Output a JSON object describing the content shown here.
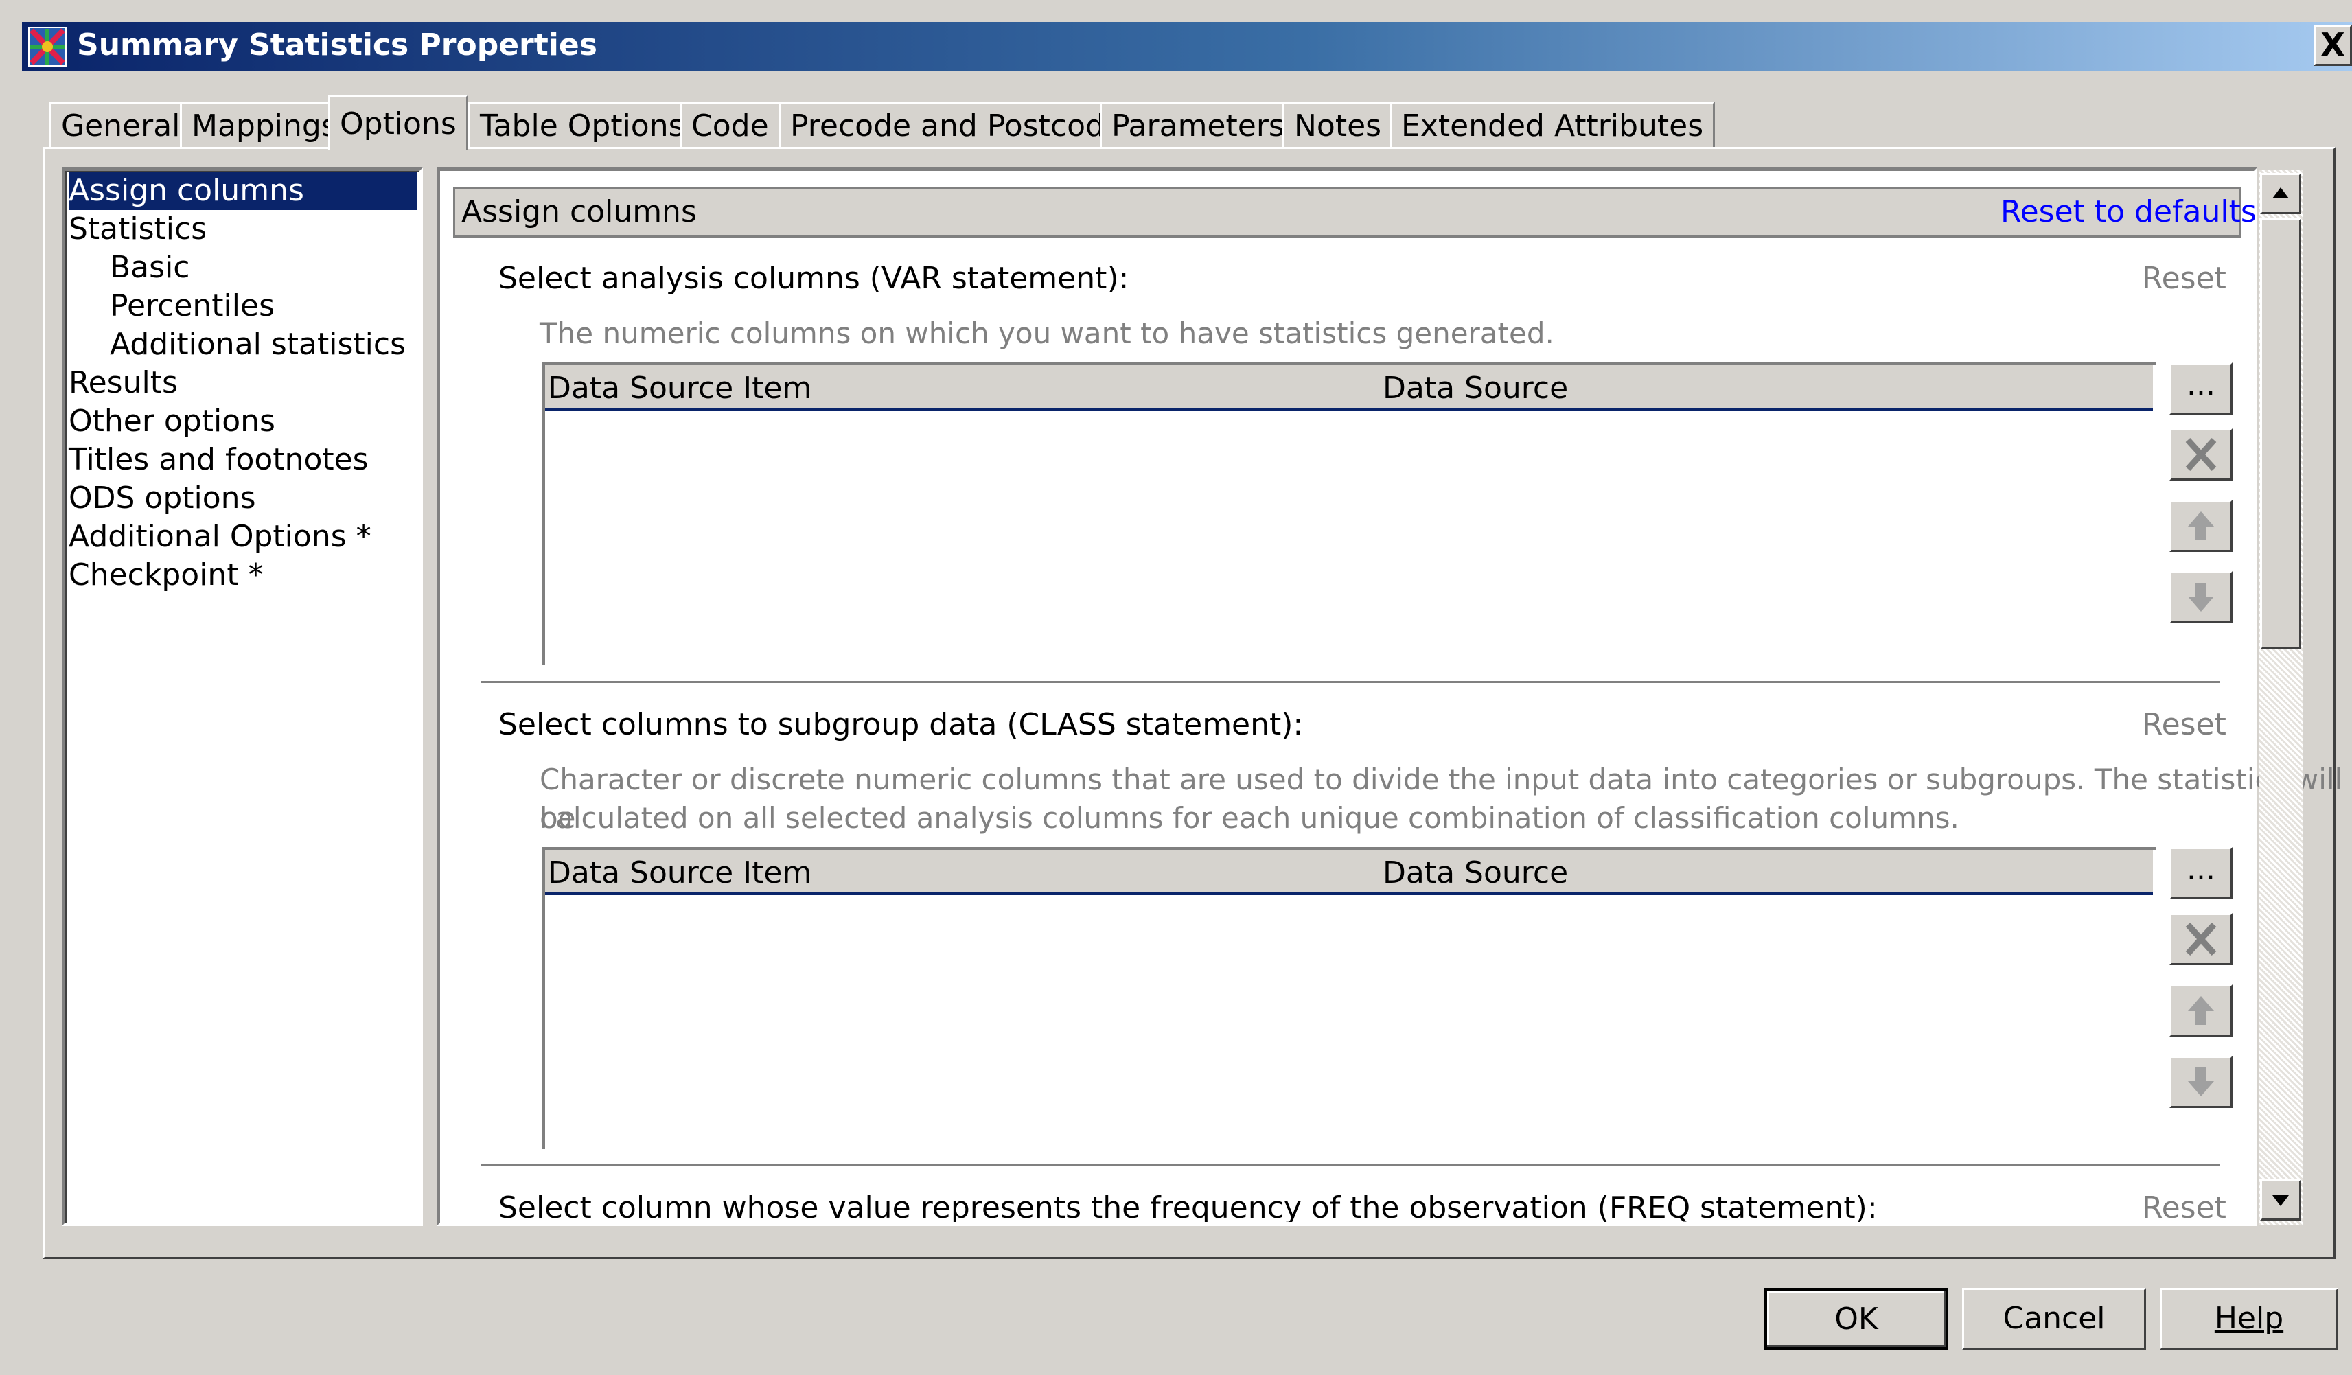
{
  "window": {
    "title": "Summary Statistics Properties",
    "close": "X"
  },
  "tabs": [
    {
      "label": "General"
    },
    {
      "label": "Mappings"
    },
    {
      "label": "Options"
    },
    {
      "label": "Table Options"
    },
    {
      "label": "Code"
    },
    {
      "label": "Precode and Postcode"
    },
    {
      "label": "Parameters"
    },
    {
      "label": "Notes"
    },
    {
      "label": "Extended Attributes"
    }
  ],
  "nav": {
    "items": [
      {
        "label": "Assign columns"
      },
      {
        "label": "Statistics"
      },
      {
        "label": "Basic"
      },
      {
        "label": "Percentiles"
      },
      {
        "label": "Additional statistics"
      },
      {
        "label": "Results"
      },
      {
        "label": "Other options"
      },
      {
        "label": "Titles and footnotes"
      },
      {
        "label": "ODS options"
      },
      {
        "label": "Additional Options *"
      },
      {
        "label": "Checkpoint *"
      }
    ]
  },
  "main": {
    "header_title": "Assign columns",
    "reset_defaults": "Reset to defaults",
    "sections": [
      {
        "label": "Select analysis columns (VAR statement):",
        "reset": "Reset",
        "description": "The numeric columns on which you want to have statistics generated.",
        "col1": "Data Source Item",
        "col2": "Data Source",
        "browse": "..."
      },
      {
        "label": "Select columns to subgroup data (CLASS statement):",
        "reset": "Reset",
        "description_line1": "Character or discrete numeric columns that are used to divide the input data into categories or subgroups. The statistics will be",
        "description_line2": "calculated on all selected analysis columns for each unique combination of classification columns.",
        "col1": "Data Source Item",
        "col2": "Data Source",
        "browse": "..."
      },
      {
        "label": "Select column whose value represents the frequency of the observation (FREQ statement):",
        "reset": "Reset"
      }
    ]
  },
  "buttons": {
    "ok": "OK",
    "cancel": "Cancel",
    "help": "Help"
  },
  "colors": {
    "selection": "#0a246a",
    "link": "#0000ff",
    "face": "#d6d3ce"
  }
}
